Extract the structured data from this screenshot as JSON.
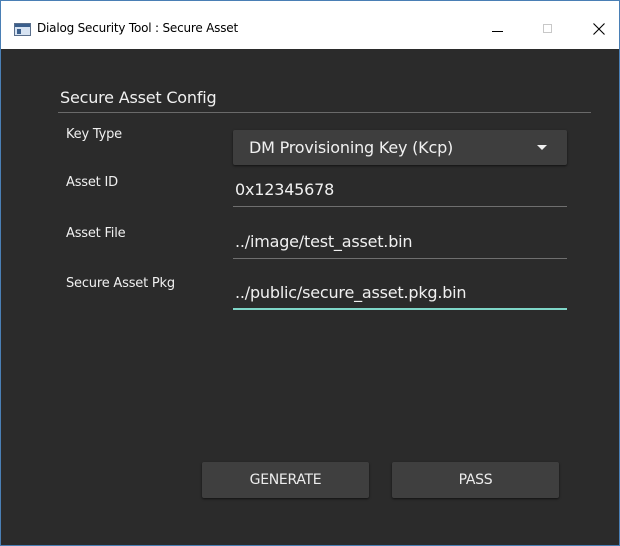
{
  "window": {
    "title": "Dialog Security Tool : Secure Asset"
  },
  "section": {
    "title": "Secure Asset Config"
  },
  "fields": {
    "key_type": {
      "label": "Key Type",
      "value": "DM Provisioning Key (Kcp)"
    },
    "asset_id": {
      "label": "Asset ID",
      "value": "0x12345678"
    },
    "asset_file": {
      "label": "Asset File",
      "value": "../image/test_asset.bin"
    },
    "secure_asset_pkg": {
      "label": "Secure Asset Pkg",
      "value": "../public/secure_asset.pkg.bin"
    }
  },
  "buttons": {
    "generate": "GENERATE",
    "pass": "PASS"
  },
  "colors": {
    "background": "#2b2b2b",
    "control": "#3f3f3f",
    "focus_accent": "#7fd6c8"
  },
  "icons": {
    "app": "app-window-icon",
    "dropdown": "chevron-down-icon",
    "close": "close-icon"
  }
}
